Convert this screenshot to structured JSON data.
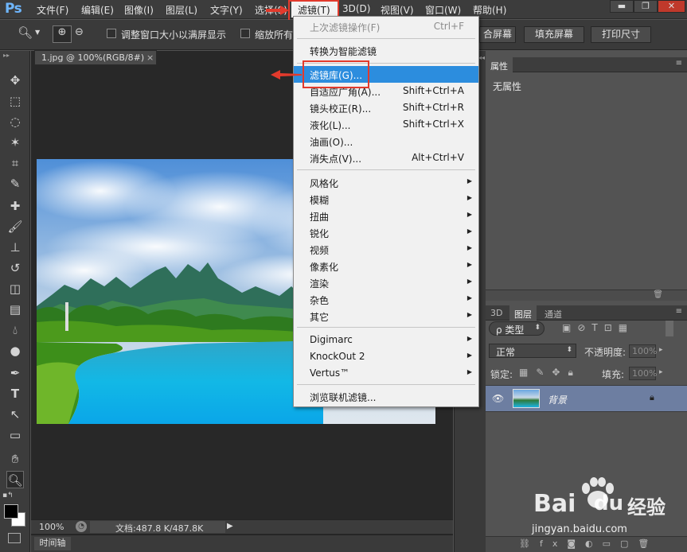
{
  "app": {
    "logo": "Ps"
  },
  "menubar": {
    "items": [
      "文件(F)",
      "编辑(E)",
      "图像(I)",
      "图层(L)",
      "文字(Y)",
      "选择(S)",
      "滤镜(T)",
      "3D(D)",
      "视图(V)",
      "窗口(W)",
      "帮助(H)"
    ],
    "active": "滤镜(T)"
  },
  "window_controls": {
    "minimize": "▬",
    "restore": "❐",
    "close": "✕"
  },
  "options_bar": {
    "checkbox1_label": "调整窗口大小以满屏显示",
    "checkbox2_label": "缩放所有",
    "btn_fit_screen": "合屏幕",
    "btn_fill_screen": "填充屏幕",
    "btn_print_size": "打印尺寸"
  },
  "document": {
    "tab_title": "1.jpg @ 100%(RGB/8#)",
    "tab_close": "×",
    "zoom": "100%",
    "doc_info": "文档:487.8 K/487.8K",
    "timeline_label": "时间轴"
  },
  "filter_menu": {
    "items": [
      {
        "label": "上次滤镜操作(F)",
        "shortcut": "Ctrl+F",
        "disabled": true
      },
      {
        "label": "转换为智能滤镜"
      },
      {
        "label": "滤镜库(G)...",
        "highlighted": true
      },
      {
        "label": "自适应广角(A)...",
        "shortcut": "Shift+Ctrl+A"
      },
      {
        "label": "镜头校正(R)...",
        "shortcut": "Shift+Ctrl+R"
      },
      {
        "label": "液化(L)...",
        "shortcut": "Shift+Ctrl+X"
      },
      {
        "label": "油画(O)..."
      },
      {
        "label": "消失点(V)...",
        "shortcut": "Alt+Ctrl+V"
      },
      {
        "label": "风格化",
        "submenu": true
      },
      {
        "label": "模糊",
        "submenu": true
      },
      {
        "label": "扭曲",
        "submenu": true
      },
      {
        "label": "锐化",
        "submenu": true
      },
      {
        "label": "视频",
        "submenu": true
      },
      {
        "label": "像素化",
        "submenu": true
      },
      {
        "label": "渲染",
        "submenu": true
      },
      {
        "label": "杂色",
        "submenu": true
      },
      {
        "label": "其它",
        "submenu": true
      },
      {
        "label": "Digimarc",
        "submenu": true
      },
      {
        "label": "KnockOut 2",
        "submenu": true
      },
      {
        "label": "Vertus™",
        "submenu": true
      },
      {
        "label": "浏览联机滤镜..."
      }
    ]
  },
  "properties_panel": {
    "tab": "属性",
    "content": "无属性"
  },
  "layers_panel": {
    "tabs": [
      "3D",
      "图层",
      "通道"
    ],
    "active_tab": "图层",
    "filter_kind": "ρ 类型",
    "blend_mode": "正常",
    "opacity_label": "不透明度:",
    "opacity_value": "100%",
    "lock_label": "锁定:",
    "fill_label": "填充:",
    "fill_value": "100%",
    "layer_name": "背景"
  },
  "watermark": {
    "brand": "Bai",
    "brand2": "du",
    "sub": "经验",
    "url": "jingyan.baidu.com"
  },
  "colors": {
    "accent": "#2c8dde",
    "annotation": "#e23a2c",
    "layer_selected": "#6d7ea1"
  }
}
